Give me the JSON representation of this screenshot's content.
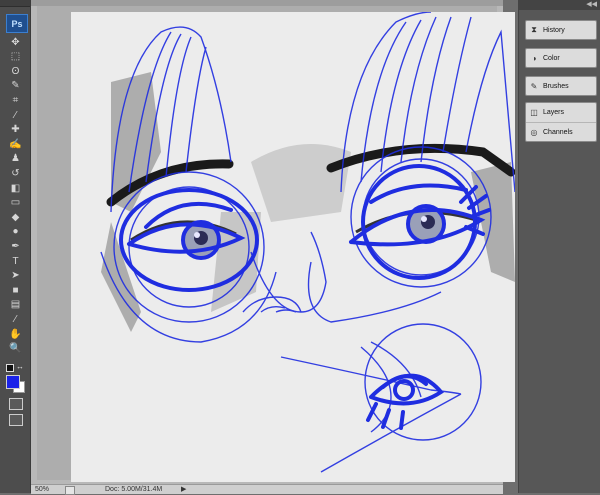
{
  "app": {
    "logo_text": "Ps"
  },
  "tools": [
    {
      "name": "move-tool-icon",
      "glyph": "✥"
    },
    {
      "name": "marquee-tool-icon",
      "glyph": "⬚"
    },
    {
      "name": "lasso-tool-icon",
      "glyph": "ʘ"
    },
    {
      "name": "quick-select-tool-icon",
      "glyph": "✎"
    },
    {
      "name": "crop-tool-icon",
      "glyph": "⌗"
    },
    {
      "name": "eyedropper-tool-icon",
      "glyph": "⁄"
    },
    {
      "name": "healing-tool-icon",
      "glyph": "✚"
    },
    {
      "name": "brush-tool-icon",
      "glyph": "✍"
    },
    {
      "name": "stamp-tool-icon",
      "glyph": "♟"
    },
    {
      "name": "history-brush-tool-icon",
      "glyph": "↺"
    },
    {
      "name": "eraser-tool-icon",
      "glyph": "◧"
    },
    {
      "name": "gradient-tool-icon",
      "glyph": "▭"
    },
    {
      "name": "blur-tool-icon",
      "glyph": "◆"
    },
    {
      "name": "dodge-tool-icon",
      "glyph": "●"
    },
    {
      "name": "pen-tool-icon",
      "glyph": "✒"
    },
    {
      "name": "type-tool-icon",
      "glyph": "T"
    },
    {
      "name": "path-select-tool-icon",
      "glyph": "➤"
    },
    {
      "name": "shape-tool-icon",
      "glyph": "■"
    },
    {
      "name": "notes-tool-icon",
      "glyph": "▤"
    },
    {
      "name": "eyedropper3d-tool-icon",
      "glyph": "⁄"
    },
    {
      "name": "hand-tool-icon",
      "glyph": "✋"
    },
    {
      "name": "zoom-tool-icon",
      "glyph": "🔍"
    }
  ],
  "colors": {
    "foreground": "#1a22e8",
    "background": "#ffffff",
    "sketch_blue": "#1f2de0"
  },
  "panels": {
    "history": "History",
    "color": "Color",
    "brushes": "Brushes",
    "layers": "Layers",
    "channels": "Channels"
  },
  "status": {
    "zoom": "50%",
    "doc_info": "Doc: 5.00M/31.4M"
  }
}
